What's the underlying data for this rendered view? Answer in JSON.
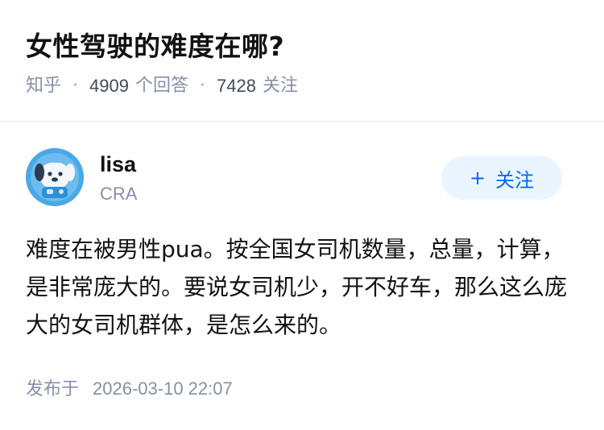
{
  "question": {
    "title": "女性驾驶的难度在哪?",
    "source": "知乎",
    "answer_count": "4909",
    "answer_label": "个回答",
    "follow_count": "7428",
    "follow_label": "关注",
    "separator": "·"
  },
  "author": {
    "name": "lisa",
    "bio": "CRA",
    "avatar_icon": "avatar-cartoon-dog-icon",
    "follow_button": {
      "plus": "+",
      "label": "关注"
    }
  },
  "answer": {
    "text": "难度在被男性pua。按全国女司机数量，总量，计算，是非常庞大的。要说女司机少，开不好车，那么这么庞大的女司机群体，是怎么来的。",
    "published_label": "发布于",
    "published_time": "2026-03-10 22:07"
  },
  "colors": {
    "accent": "#0066ff",
    "follow_bg": "#ebf5ff",
    "meta_gray": "#8590a6",
    "avatar_bg": "#4aa8e6"
  }
}
